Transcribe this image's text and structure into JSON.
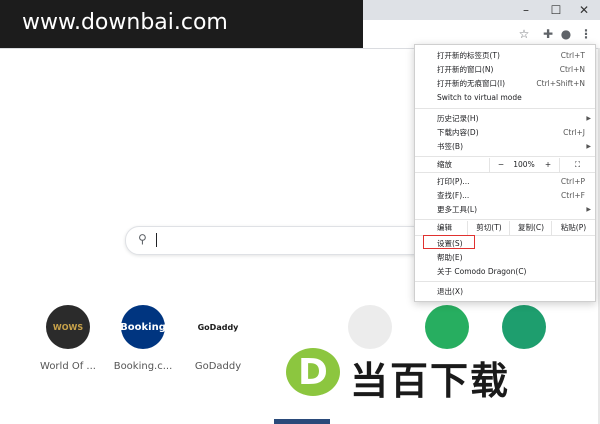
{
  "watermark": {
    "text": "www.downbai.com"
  },
  "window": {
    "minimize": "–",
    "maximize": "☐",
    "close": "✕"
  },
  "toolbar": {
    "star": "☆",
    "extensions": "✚",
    "profile": "●",
    "menu": "⋮"
  },
  "search": {
    "icon": "⚲"
  },
  "shortcuts": [
    {
      "label": "World Of ...",
      "icon_text": "WOWS",
      "color": "#2b2b2b"
    },
    {
      "label": "Booking.c...",
      "icon_text": "Booking",
      "color": "#003580"
    },
    {
      "label": "GoDaddy",
      "icon_text": "GoDaddy",
      "color": "#ffffff"
    }
  ],
  "menu": {
    "new_tab": {
      "label": "打开新的标签页(T)",
      "shortcut": "Ctrl+T"
    },
    "new_window": {
      "label": "打开新的窗口(N)",
      "shortcut": "Ctrl+N"
    },
    "incognito": {
      "label": "打开新的无痕窗口(I)",
      "shortcut": "Ctrl+Shift+N"
    },
    "virtual_mode": {
      "label": "Switch to virtual mode"
    },
    "history": {
      "label": "历史记录(H)"
    },
    "downloads": {
      "label": "下载内容(D)",
      "shortcut": "Ctrl+J"
    },
    "bookmarks": {
      "label": "书签(B)"
    },
    "zoom": {
      "label": "缩放",
      "minus": "−",
      "value": "100%",
      "plus": "+",
      "fullscreen": "⛶"
    },
    "print": {
      "label": "打印(P)...",
      "shortcut": "Ctrl+P"
    },
    "find": {
      "label": "查找(F)...",
      "shortcut": "Ctrl+F"
    },
    "more_tools": {
      "label": "更多工具(L)"
    },
    "edit": {
      "label": "编辑",
      "cut": "剪切(T)",
      "copy": "复制(C)",
      "paste": "粘贴(P)"
    },
    "settings": {
      "label": "设置(S)"
    },
    "help": {
      "label": "帮助(E)"
    },
    "about": {
      "label": "关于 Comodo Dragon(C)"
    },
    "exit": {
      "label": "退出(X)"
    }
  },
  "bottom_logo": {
    "letter": "D",
    "text": "当百下载"
  },
  "colors": {
    "highlight": "#e0312f",
    "logo_green": "#8cc63f"
  }
}
